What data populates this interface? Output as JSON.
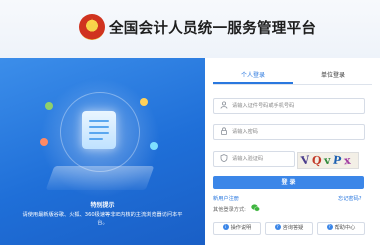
{
  "header": {
    "title": "全国会计人员统一服务管理平台"
  },
  "hero": {
    "notice_title": "特别提示",
    "notice_text": "请使用最新版谷歌、火狐、360极速等非IE内核的主流浏览器访问本平台。"
  },
  "login": {
    "tabs": [
      {
        "label": "个人登录",
        "active": true
      },
      {
        "label": "单位登录",
        "active": false
      }
    ],
    "id_field": {
      "placeholder": "请输入证件号码或手机号码",
      "icon": "user-icon"
    },
    "password_field": {
      "placeholder": "请输入密码",
      "icon": "lock-icon"
    },
    "captcha_field": {
      "placeholder": "请输入验证码",
      "icon": "shield-icon"
    },
    "captcha_text": "VQvPx",
    "login_button": "登 录",
    "register_link": "新用户注册",
    "forgot_link": "忘记密码?",
    "other_login": "其他登录方式:",
    "other_login_icon": "wechat-icon"
  },
  "footer": {
    "buttons": [
      {
        "label": "操作说明",
        "icon": "info-icon"
      },
      {
        "label": "咨询答疑",
        "icon": "question-icon"
      },
      {
        "label": "帮助中心",
        "icon": "help-icon"
      }
    ]
  },
  "colors": {
    "accent": "#2a78df",
    "hero_blue": "#1f6fd8",
    "login_button": "#3b86e8"
  }
}
